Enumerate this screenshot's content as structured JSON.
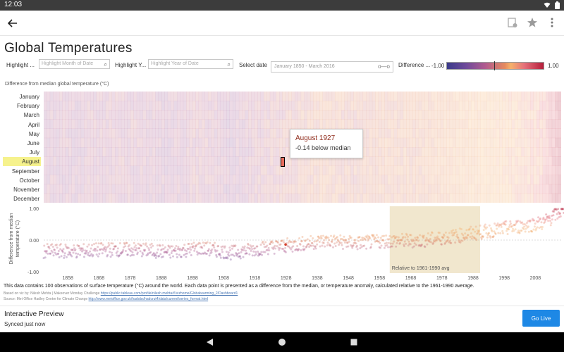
{
  "status_bar": {
    "time": "12:03",
    "icons": [
      "wifi-icon",
      "battery-icon"
    ]
  },
  "app_bar": {
    "back_icon": "arrow-left-icon",
    "actions": [
      "comment-icon",
      "star-icon",
      "more-vert-icon"
    ]
  },
  "dashboard": {
    "title": "Global Temperatures",
    "filters": {
      "month_label": "Highlight ...",
      "month_placeholder": "Highlight Month of Date",
      "year_label": "Highlight Y...",
      "year_placeholder": "Highlight Year of Date",
      "date_label": "Select date",
      "date_value": "January 1850 - March 2016"
    },
    "legend": {
      "label": "Difference ...",
      "min": "-1.00",
      "max": "1.00"
    },
    "heatmap_title": "Difference from median global temperature (°C)",
    "months": [
      "January",
      "February",
      "March",
      "April",
      "May",
      "June",
      "July",
      "August",
      "September",
      "October",
      "November",
      "December"
    ],
    "highlighted_month": "August",
    "tooltip": {
      "title": "August 1927",
      "text": "-0.14 below median"
    },
    "scatter": {
      "y_title": "Difference from median temperature (°C)",
      "y_ticks": [
        "1.00",
        "0.00",
        "-1.00"
      ],
      "band_label": "Relative to 1961-1990 avg",
      "x_ticks": [
        "1858",
        "1868",
        "1878",
        "1888",
        "1898",
        "1908",
        "1918",
        "1928",
        "1938",
        "1948",
        "1958",
        "1968",
        "1978",
        "1988",
        "1998",
        "2008"
      ]
    },
    "footnote": "This data contains 100 observations of surface temperature (°C) around the world. Each data point is presented as a difference from the median, or temperature anomaly, calculated relative to the 1961-1990 average.",
    "credits": {
      "line1_prefix": "Based on viz by: Nilesh Mehta | Makeover Monday Challenge",
      "line1_link": "https://public.tableau.com/profile/nilesh.mehta#!/vizhome/Globalwarming_2/Dashboard1",
      "line2_prefix": "Source: Met Office Hadley Centre for Climate Change",
      "line2_link": "http://www.metoffice.gov.uk/hadobs/hadcrut4/data/current/series_format.html"
    }
  },
  "chart_data": {
    "type": "scatter",
    "title": "",
    "xlabel": "",
    "ylabel": "Difference from median temperature (°C)",
    "xlim": [
      1850,
      2016
    ],
    "ylim": [
      -1.0,
      1.0
    ],
    "reference_band": {
      "label": "Relative to 1961-1990 avg",
      "from": 1961,
      "to": 1990
    },
    "highlight": {
      "label": "August 1927",
      "value": -0.14
    },
    "trend": {
      "x": [
        1850,
        1860,
        1870,
        1880,
        1890,
        1900,
        1910,
        1920,
        1930,
        1940,
        1950,
        1960,
        1970,
        1980,
        1990,
        2000,
        2010,
        2016
      ],
      "y": [
        -0.35,
        -0.35,
        -0.3,
        -0.3,
        -0.38,
        -0.25,
        -0.4,
        -0.25,
        -0.15,
        -0.02,
        -0.1,
        -0.02,
        -0.02,
        0.1,
        0.25,
        0.4,
        0.55,
        0.95
      ]
    }
  },
  "bottom_bar": {
    "title": "Interactive Preview",
    "subtitle": "Synced just now",
    "go_live": "Go Live"
  },
  "nav_bar": {
    "buttons": [
      "back-triangle-icon",
      "home-circle-icon",
      "recents-square-icon"
    ]
  }
}
